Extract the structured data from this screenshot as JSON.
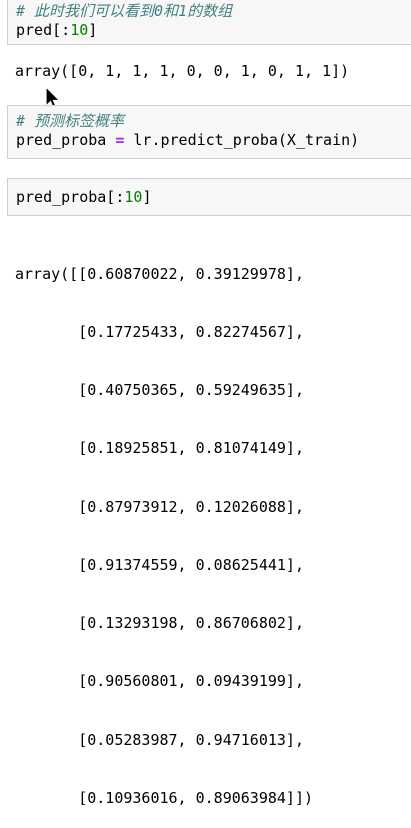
{
  "cells": [
    {
      "comment": "# 此时我们可以看到0和1的数组",
      "code_prefix": "pred[:",
      "code_number": "10",
      "code_suffix": "]",
      "output": "array([0, 1, 1, 1, 0, 0, 1, 0, 1, 1])"
    },
    {
      "comment": "# 预测标签概率",
      "code_left": "pred_proba ",
      "code_op": "=",
      "code_right": " lr.predict_proba(X_train)"
    },
    {
      "code_prefix": "pred_proba[:",
      "code_number": "10",
      "code_suffix": "]",
      "output_lines": [
        "array([[0.60870022, 0.39129978],",
        "       [0.17725433, 0.82274567],",
        "       [0.40750365, 0.59249635],",
        "       [0.18925851, 0.81074149],",
        "       [0.87973912, 0.12026088],",
        "       [0.91374559, 0.08625441],",
        "       [0.13293198, 0.86706802],",
        "       [0.90560801, 0.09439199],",
        "       [0.05283987, 0.94716013],",
        "       [0.10936016, 0.89063984]])"
      ]
    }
  ]
}
